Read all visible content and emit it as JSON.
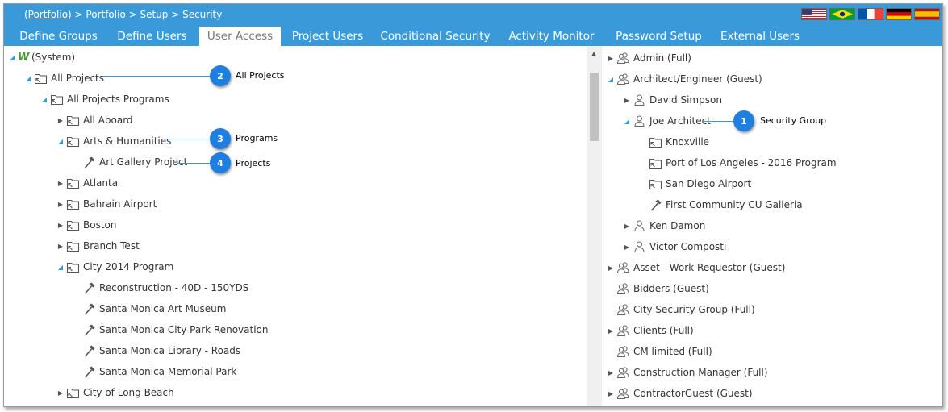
{
  "breadcrumb": {
    "portfolio_link": "(Portfolio)",
    "rest": " > Portfolio > Setup > Security"
  },
  "flags": [
    {
      "name": "us-flag-icon"
    },
    {
      "name": "brazil-flag-icon"
    },
    {
      "name": "france-flag-icon"
    },
    {
      "name": "germany-flag-icon"
    },
    {
      "name": "spain-flag-icon"
    }
  ],
  "tabs": [
    {
      "label": "Define Groups",
      "active": false
    },
    {
      "label": "Define Users",
      "active": false
    },
    {
      "label": "User Access",
      "active": true
    },
    {
      "label": "Project Users",
      "active": false
    },
    {
      "label": "Conditional Security",
      "active": false
    },
    {
      "label": "Activity Monitor",
      "active": false
    },
    {
      "label": "Password Setup",
      "active": false
    },
    {
      "label": "External Users",
      "active": false
    }
  ],
  "left_tree": [
    {
      "label": "(System)",
      "level": 0,
      "toggle": "expanded",
      "icon": "system-logo-icon"
    },
    {
      "label": "All Projects",
      "level": 1,
      "toggle": "expanded",
      "icon": "folder-icon"
    },
    {
      "label": "All Projects Programs",
      "level": 2,
      "toggle": "expanded",
      "icon": "folder-icon"
    },
    {
      "label": "All Aboard",
      "level": 3,
      "toggle": "collapsed",
      "icon": "folder-icon"
    },
    {
      "label": "Arts & Humanities",
      "level": 3,
      "toggle": "expanded",
      "icon": "folder-icon"
    },
    {
      "label": "Art Gallery Project",
      "level": 4,
      "toggle": "none",
      "icon": "hammer-icon"
    },
    {
      "label": "Atlanta",
      "level": 3,
      "toggle": "collapsed",
      "icon": "folder-icon"
    },
    {
      "label": "Bahrain Airport",
      "level": 3,
      "toggle": "collapsed",
      "icon": "folder-icon"
    },
    {
      "label": "Boston",
      "level": 3,
      "toggle": "collapsed",
      "icon": "folder-icon"
    },
    {
      "label": "Branch Test",
      "level": 3,
      "toggle": "collapsed",
      "icon": "folder-icon"
    },
    {
      "label": "City 2014 Program",
      "level": 3,
      "toggle": "expanded",
      "icon": "folder-icon"
    },
    {
      "label": "Reconstruction - 40D - 150YDS",
      "level": 4,
      "toggle": "none",
      "icon": "hammer-icon"
    },
    {
      "label": "Santa Monica Art Museum",
      "level": 4,
      "toggle": "none",
      "icon": "hammer-icon"
    },
    {
      "label": "Santa Monica City Park Renovation",
      "level": 4,
      "toggle": "none",
      "icon": "hammer-icon"
    },
    {
      "label": "Santa Monica Library - Roads",
      "level": 4,
      "toggle": "none",
      "icon": "hammer-icon"
    },
    {
      "label": "Santa Monica Memorial Park",
      "level": 4,
      "toggle": "none",
      "icon": "hammer-icon"
    },
    {
      "label": "City of Long Beach",
      "level": 3,
      "toggle": "collapsed",
      "icon": "folder-icon"
    }
  ],
  "right_tree": [
    {
      "label": "Admin (Full)",
      "level": 0,
      "toggle": "collapsed",
      "icon": "group-icon"
    },
    {
      "label": "Architect/Engineer (Guest)",
      "level": 0,
      "toggle": "expanded",
      "icon": "group-icon"
    },
    {
      "label": "David Simpson",
      "level": 1,
      "toggle": "collapsed",
      "icon": "user-icon"
    },
    {
      "label": "Joe Architect",
      "level": 1,
      "toggle": "expanded",
      "icon": "user-icon"
    },
    {
      "label": "Knoxville",
      "level": 2,
      "toggle": "none",
      "icon": "folder-icon"
    },
    {
      "label": "Port of Los Angeles - 2016 Program",
      "level": 2,
      "toggle": "none",
      "icon": "folder-icon"
    },
    {
      "label": "San Diego Airport",
      "level": 2,
      "toggle": "none",
      "icon": "folder-icon"
    },
    {
      "label": "First Community CU Galleria",
      "level": 2,
      "toggle": "none",
      "icon": "hammer-icon"
    },
    {
      "label": "Ken Damon",
      "level": 1,
      "toggle": "collapsed",
      "icon": "user-icon"
    },
    {
      "label": "Victor Composti",
      "level": 1,
      "toggle": "collapsed",
      "icon": "user-icon"
    },
    {
      "label": "Asset - Work Requestor (Guest)",
      "level": 0,
      "toggle": "collapsed",
      "icon": "group-icon"
    },
    {
      "label": "Bidders (Guest)",
      "level": 0,
      "toggle": "none",
      "icon": "group-icon"
    },
    {
      "label": "City Security Group (Full)",
      "level": 0,
      "toggle": "none",
      "icon": "group-icon"
    },
    {
      "label": "Clients (Full)",
      "level": 0,
      "toggle": "collapsed",
      "icon": "group-icon"
    },
    {
      "label": "CM limited (Full)",
      "level": 0,
      "toggle": "none",
      "icon": "group-icon"
    },
    {
      "label": "Construction Manager (Full)",
      "level": 0,
      "toggle": "collapsed",
      "icon": "group-icon"
    },
    {
      "label": "ContractorGuest (Guest)",
      "level": 0,
      "toggle": "collapsed",
      "icon": "group-icon"
    }
  ],
  "callouts": [
    {
      "number": "1",
      "text": "Security Group"
    },
    {
      "number": "2",
      "text": "All Projects"
    },
    {
      "number": "3",
      "text": "Programs"
    },
    {
      "number": "4",
      "text": "Projects"
    }
  ],
  "colors": {
    "accent": "#3a9ad9",
    "badge": "#1e7fe0",
    "system_logo": "#4a9c3a"
  }
}
